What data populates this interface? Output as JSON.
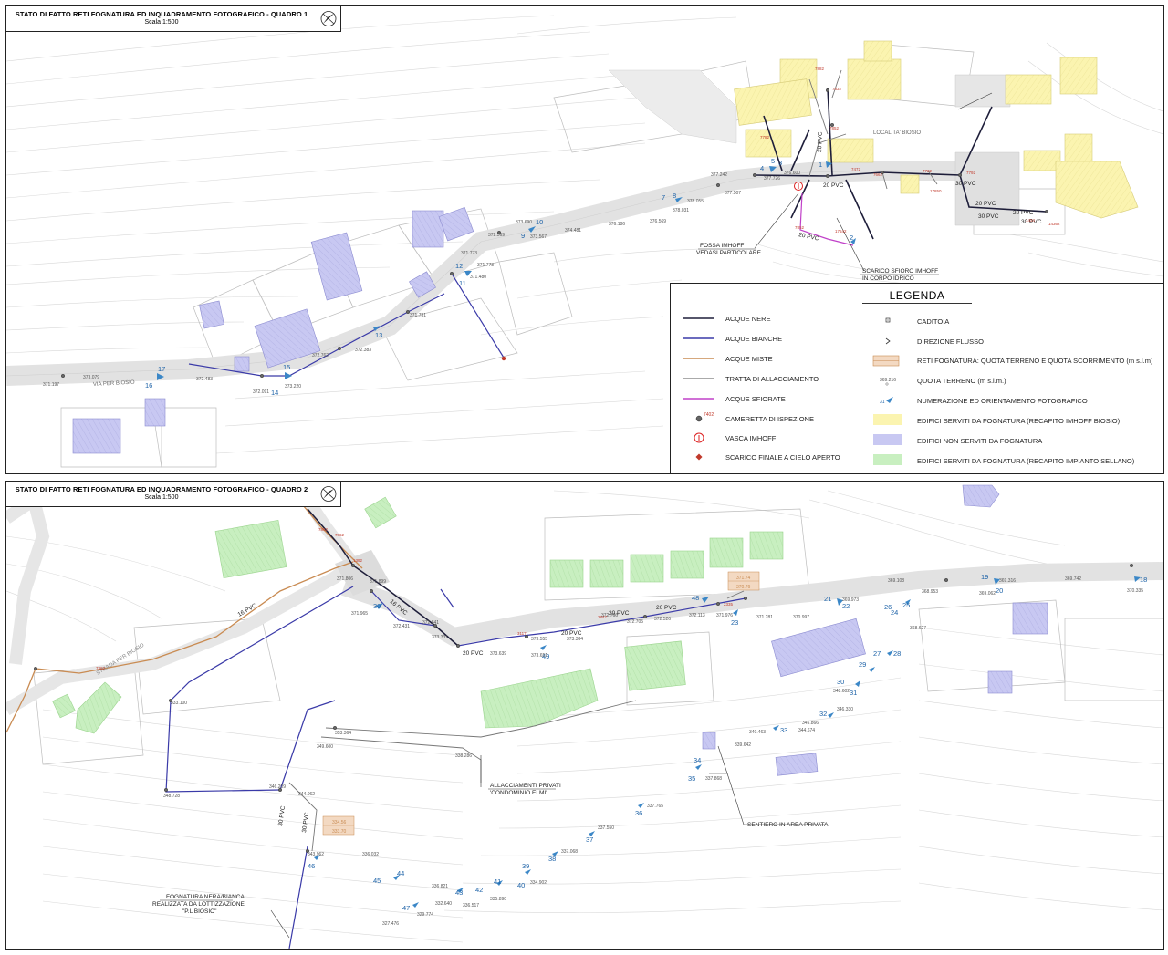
{
  "panel1": {
    "title": "STATO DI FATTO RETI FOGNATURA ED INQUADRAMENTO FOTOGRAFICO - QUADRO 1",
    "scale": "Scala 1:500",
    "place_label": "LOCALITA' BIOSIO",
    "road_label": "VIA PER BIOSIO",
    "pipe_labels": [
      "20 PVC",
      "20 PVC",
      "20 PVC",
      "30 PVC",
      "20 PVC",
      "30 PVC",
      "30 PVC",
      "20 PVC"
    ],
    "photo_numbers": [
      "17",
      "16",
      "15",
      "14",
      "13",
      "12",
      "11",
      "10",
      "9",
      "7",
      "8",
      "5",
      "4",
      "3",
      "1",
      "2"
    ],
    "elevations": [
      "373.079",
      "372.483",
      "371.197",
      "373.220",
      "372.091",
      "372.762",
      "372.383",
      "371.781",
      "371.773",
      "371.480",
      "371.773",
      "373.567",
      "373.690",
      "372.569",
      "374.481",
      "376.186",
      "376.569",
      "378.031",
      "378.055",
      "377.242",
      "377.507",
      "377.726",
      "376.600"
    ],
    "annotations": {
      "imhoff": "FOSSA IMHOFF",
      "imhoff_sub": "VEDASI PARTICOLARE",
      "overflow": "SCARICO SFIORO IMHOFF",
      "overflow_sub": "IN CORPO IDRICO"
    },
    "legend": {
      "title": "LEGENDA",
      "left": [
        {
          "label": "ACQUE NERE",
          "color": "#1e1e3a"
        },
        {
          "label": "ACQUE BIANCHE",
          "color": "#3a3aa8"
        },
        {
          "label": "ACQUE MISTE",
          "color": "#c98b52"
        },
        {
          "label": "TRATTA DI ALLACCIAMENTO",
          "color": "#777777"
        },
        {
          "label": "ACQUE SFIORATE",
          "color": "#c040c8"
        },
        {
          "label": "CAMERETTA DI ISPEZIONE"
        },
        {
          "label": "VASCA IMHOFF"
        },
        {
          "label": "SCARICO FINALE A CIELO APERTO"
        }
      ],
      "right": [
        {
          "label": "CADITOIA"
        },
        {
          "label": "DIREZIONE FLUSSO"
        },
        {
          "label": "RETI FOGNATURA: QUOTA TERRENO E QUOTA SCORRIMENTO (m s.l.m)"
        },
        {
          "label": "QUOTA TERRENO (m s.l.m.)"
        },
        {
          "label": "NUMERAZIONE ED ORIENTAMENTO FOTOGRAFICO"
        },
        {
          "label": "EDIFICI SERVITI DA FOGNATURA (RECAPITO IMHOFF BIOSIO)",
          "color": "#fbf4b0"
        },
        {
          "label": "EDIFICI NON SERVITI DA FOGNATURA",
          "color": "#c8c8f2"
        },
        {
          "label": "EDIFICI SERVITI DA FOGNATURA (RECAPITO IMPIANTO SELLANO)",
          "color": "#c8efc0"
        }
      ],
      "manhole_sample": "7402",
      "elevation_sample": "369.216",
      "photo_sample": "31"
    }
  },
  "panel2": {
    "title": "STATO DI FATTO RETI FOGNATURA ED INQUADRAMENTO FOTOGRAFICO - QUADRO 2",
    "scale": "Scala 1:500",
    "road_label": "STRADA PER BIOSIO",
    "pipe_labels": [
      "16 PVC",
      "20 PVC",
      "20 PVC",
      "20 PVC",
      "20 PVC",
      "30 PVC",
      "30 PVC",
      "16 PVC"
    ],
    "photo_numbers": [
      "30",
      "49",
      "48",
      "23",
      "22",
      "21",
      "24",
      "25",
      "19",
      "20",
      "18",
      "26",
      "27",
      "28",
      "29",
      "30",
      "31",
      "32",
      "33",
      "34",
      "35",
      "36",
      "37",
      "38",
      "39",
      "40",
      "41",
      "42",
      "43",
      "44",
      "45",
      "46",
      "47"
    ],
    "elevations": [
      "371.806",
      "371.899",
      "371.965",
      "372.431",
      "372.841",
      "373.331",
      "373.639",
      "373.555",
      "373.651",
      "373.384",
      "372.766",
      "372.705",
      "372.526",
      "372.113",
      "371.976",
      "371.281",
      "370.997",
      "369.973",
      "369.108",
      "368.953",
      "369.062",
      "369.316",
      "369.742",
      "370.335",
      "368.627",
      "348.602",
      "346.330",
      "345.866",
      "344.674",
      "340.463",
      "339.642",
      "337.868",
      "337.765",
      "337.550",
      "337.068",
      "336.032",
      "336.821",
      "336.517",
      "335.890",
      "334.902",
      "332.640",
      "327.476",
      "329.774",
      "353.364",
      "349.600",
      "338.286",
      "346.209",
      "344.062",
      "343.962",
      "348.728",
      "333.100"
    ],
    "annotations": {
      "private": "ALLACCIAMENTI PRIVATI",
      "private_sub": "'CONDOMINIO ELMI'",
      "path": "SENTIERO IN AREA PRIVATA",
      "sewer": "FOGNATURA NERA/BIANCA",
      "sewer_sub": "REALIZZATA DA LOTTIZZAZIONE",
      "sewer_sub2": "\"P.L BIOSIO\""
    },
    "tags": [
      "371.74",
      "370.76",
      "334.56",
      "333.70"
    ]
  }
}
